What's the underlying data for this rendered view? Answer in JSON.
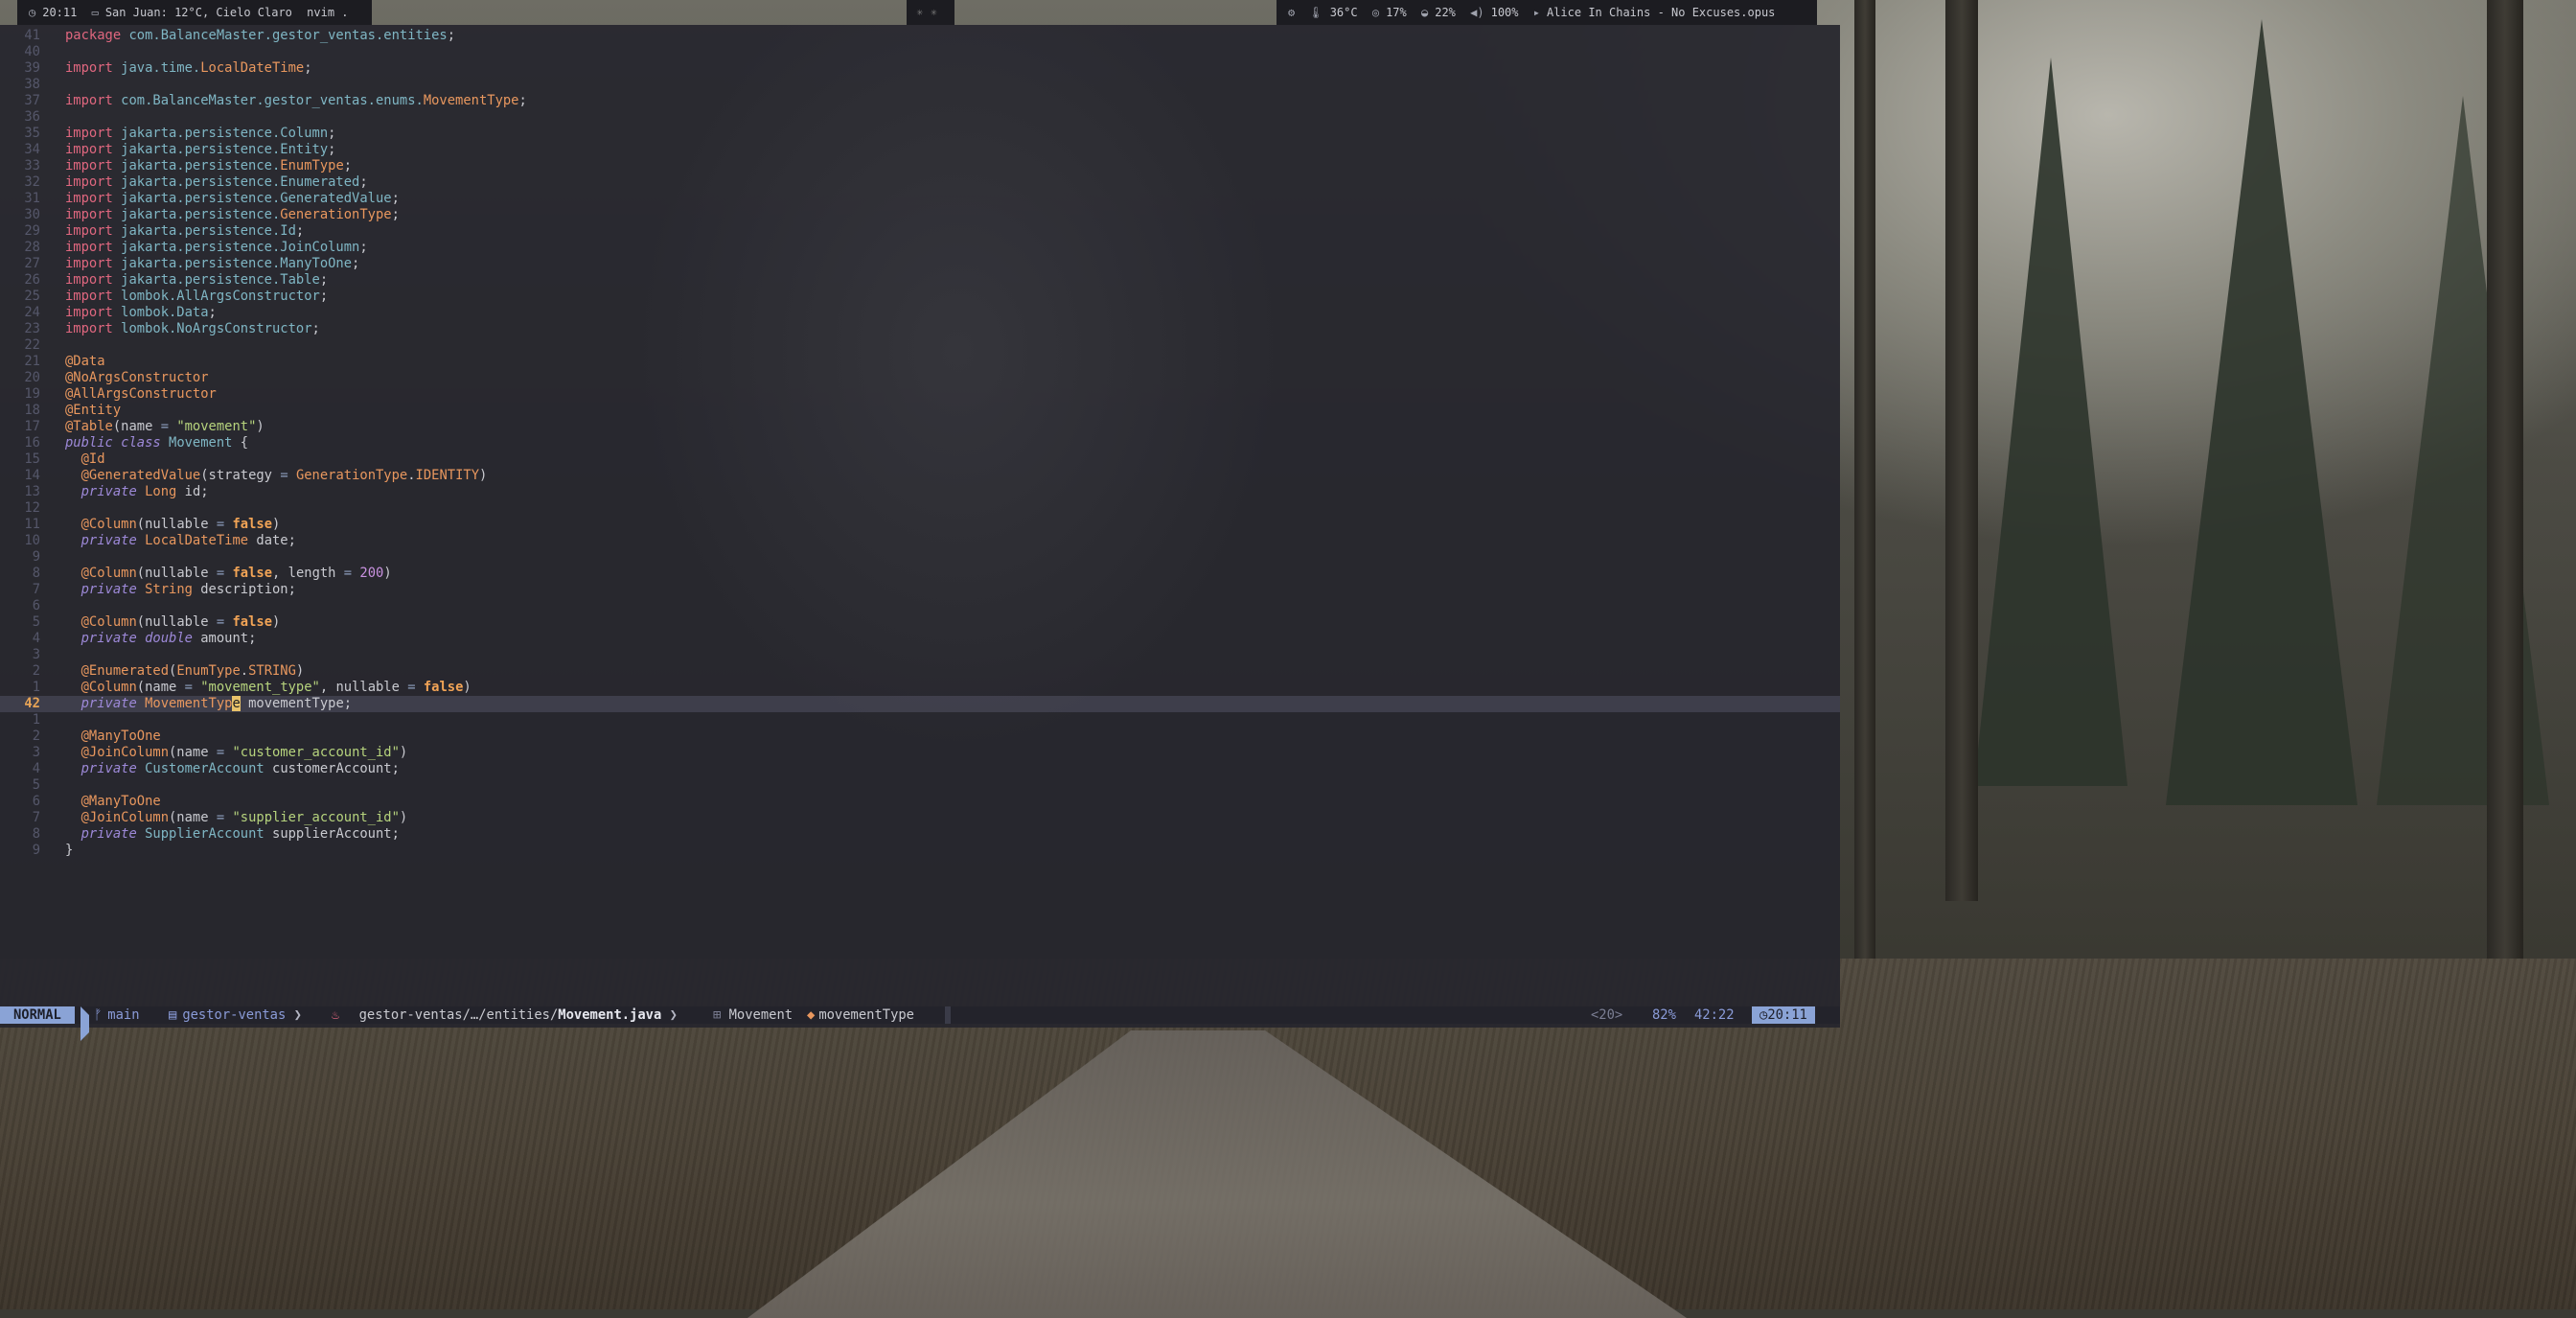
{
  "top_bar": {
    "left": {
      "clock": "20:11",
      "weather": "San Juan: 12°C, Cielo Claro",
      "active_window": "nvim ."
    },
    "right": {
      "temperature": "36°C",
      "cpu": "17%",
      "memory": "22%",
      "volume": "100%",
      "now_playing": "Alice In Chains - No Excuses.opus"
    }
  },
  "editor": {
    "statusline": {
      "mode": "NORMAL",
      "branch": "main",
      "project": "gestor-ventas",
      "file_path": "gestor-ventas/…/entities/",
      "file_name": "Movement.java",
      "breadcrumb_class": "Movement",
      "breadcrumb_symbol": "movementType",
      "register": "<20>",
      "percent": "82%",
      "position": "42:22",
      "time": "20:11"
    },
    "lines": [
      {
        "n": "41",
        "html": "<span class='kw'>package</span> <span class='pkg'>com.BalanceMaster.gestor_ventas.entities</span>;"
      },
      {
        "n": "40",
        "html": ""
      },
      {
        "n": "39",
        "html": "<span class='imp'>import</span> <span class='pkg'>java.time.</span><span class='ty'>LocalDateTime</span>;"
      },
      {
        "n": "38",
        "html": ""
      },
      {
        "n": "37",
        "html": "<span class='imp'>import</span> <span class='pkg'>com.BalanceMaster.gestor_ventas.enums.</span><span class='ty'>MovementType</span>;"
      },
      {
        "n": "36",
        "html": ""
      },
      {
        "n": "35",
        "html": "<span class='imp'>import</span> <span class='pkg'>jakarta.persistence.Column</span>;"
      },
      {
        "n": "34",
        "html": "<span class='imp'>import</span> <span class='pkg'>jakarta.persistence.Entity</span>;"
      },
      {
        "n": "33",
        "html": "<span class='imp'>import</span> <span class='pkg'>jakarta.persistence.</span><span class='ty'>EnumType</span>;"
      },
      {
        "n": "32",
        "html": "<span class='imp'>import</span> <span class='pkg'>jakarta.persistence.Enumerated</span>;"
      },
      {
        "n": "31",
        "html": "<span class='imp'>import</span> <span class='pkg'>jakarta.persistence.GeneratedValue</span>;"
      },
      {
        "n": "30",
        "html": "<span class='imp'>import</span> <span class='pkg'>jakarta.persistence.</span><span class='ty'>GenerationType</span>;"
      },
      {
        "n": "29",
        "html": "<span class='imp'>import</span> <span class='pkg'>jakarta.persistence.Id</span>;"
      },
      {
        "n": "28",
        "html": "<span class='imp'>import</span> <span class='pkg'>jakarta.persistence.JoinColumn</span>;"
      },
      {
        "n": "27",
        "html": "<span class='imp'>import</span> <span class='pkg'>jakarta.persistence.ManyToOne</span>;"
      },
      {
        "n": "26",
        "html": "<span class='imp'>import</span> <span class='pkg'>jakarta.persistence.Table</span>;"
      },
      {
        "n": "25",
        "html": "<span class='imp'>import</span> <span class='pkg'>lombok.AllArgsConstructor</span>;"
      },
      {
        "n": "24",
        "html": "<span class='imp'>import</span> <span class='pkg'>lombok.Data</span>;"
      },
      {
        "n": "23",
        "html": "<span class='imp'>import</span> <span class='pkg'>lombok.NoArgsConstructor</span>;"
      },
      {
        "n": "22",
        "html": ""
      },
      {
        "n": "21",
        "html": "<span class='ann'>@Data</span>"
      },
      {
        "n": "20",
        "html": "<span class='ann'>@NoArgsConstructor</span>"
      },
      {
        "n": "19",
        "html": "<span class='ann'>@AllArgsConstructor</span>"
      },
      {
        "n": "18",
        "html": "<span class='ann'>@Entity</span>"
      },
      {
        "n": "17",
        "html": "<span class='ann'>@Table</span>(name <span class='op'>=</span> <span class='str'>\"movement\"</span>)"
      },
      {
        "n": "16",
        "html": "<span class='it'>public</span> <span class='it'>class</span> <span class='tyc'>Movement</span> {"
      },
      {
        "n": "15",
        "html": "  <span class='ann'>@Id</span>"
      },
      {
        "n": "14",
        "html": "  <span class='ann'>@GeneratedValue</span>(strategy <span class='op'>=</span> <span class='ty'>GenerationType</span>.<span class='ty'>IDENTITY</span>)"
      },
      {
        "n": "13",
        "html": "  <span class='it'>private</span> <span class='ty'>Long</span> id;"
      },
      {
        "n": "12",
        "html": ""
      },
      {
        "n": "11",
        "html": "  <span class='ann'>@Column</span>(nullable <span class='op'>=</span> <span class='bool'>false</span>)"
      },
      {
        "n": "10",
        "html": "  <span class='it'>private</span> <span class='ty'>LocalDateTime</span> date;"
      },
      {
        "n": "9",
        "html": ""
      },
      {
        "n": "8",
        "html": "  <span class='ann'>@Column</span>(nullable <span class='op'>=</span> <span class='bool'>false</span>, length <span class='op'>=</span> <span class='num'>200</span>)"
      },
      {
        "n": "7",
        "html": "  <span class='it'>private</span> <span class='ty'>String</span> description;"
      },
      {
        "n": "6",
        "html": ""
      },
      {
        "n": "5",
        "html": "  <span class='ann'>@Column</span>(nullable <span class='op'>=</span> <span class='bool'>false</span>)"
      },
      {
        "n": "4",
        "html": "  <span class='it'>private</span> <span class='it'>double</span> amount;"
      },
      {
        "n": "3",
        "html": ""
      },
      {
        "n": "2",
        "html": "  <span class='ann'>@Enumerated</span>(<span class='ty'>EnumType</span>.<span class='ty'>STRING</span>)"
      },
      {
        "n": "1",
        "html": "  <span class='ann'>@Column</span>(name <span class='op'>=</span> <span class='str'>\"movement_type\"</span>, nullable <span class='op'>=</span> <span class='bool'>false</span>)"
      },
      {
        "n": "42",
        "html": "  <span class='it'>private</span> <span class='ty'>MovementTyp</span><span class='cursor-char'>e</span> movementType;",
        "current": true
      },
      {
        "n": "1",
        "html": ""
      },
      {
        "n": "2",
        "html": "  <span class='ann'>@ManyToOne</span>"
      },
      {
        "n": "3",
        "html": "  <span class='ann'>@JoinColumn</span>(name <span class='op'>=</span> <span class='str'>\"customer_account_id\"</span>)"
      },
      {
        "n": "4",
        "html": "  <span class='it'>private</span> <span class='tyc'>CustomerAccount</span> customerAccount;"
      },
      {
        "n": "5",
        "html": ""
      },
      {
        "n": "6",
        "html": "  <span class='ann'>@ManyToOne</span>"
      },
      {
        "n": "7",
        "html": "  <span class='ann'>@JoinColumn</span>(name <span class='op'>=</span> <span class='str'>\"supplier_account_id\"</span>)"
      },
      {
        "n": "8",
        "html": "  <span class='it'>private</span> <span class='tyc'>SupplierAccount</span> supplierAccount;"
      },
      {
        "n": "9",
        "html": "}"
      }
    ]
  },
  "colors": {
    "accent": "#8aa3d6",
    "keyword": "#e0677f",
    "type": "#e8975e",
    "string": "#b6d37d",
    "package": "#7fb6c4"
  },
  "icons": [
    "clock-icon",
    "folder-icon",
    "thermometer-icon",
    "cpu-icon",
    "memory-icon",
    "volume-icon",
    "play-icon",
    "git-branch-icon",
    "java-icon",
    "class-icon",
    "tag-icon"
  ]
}
